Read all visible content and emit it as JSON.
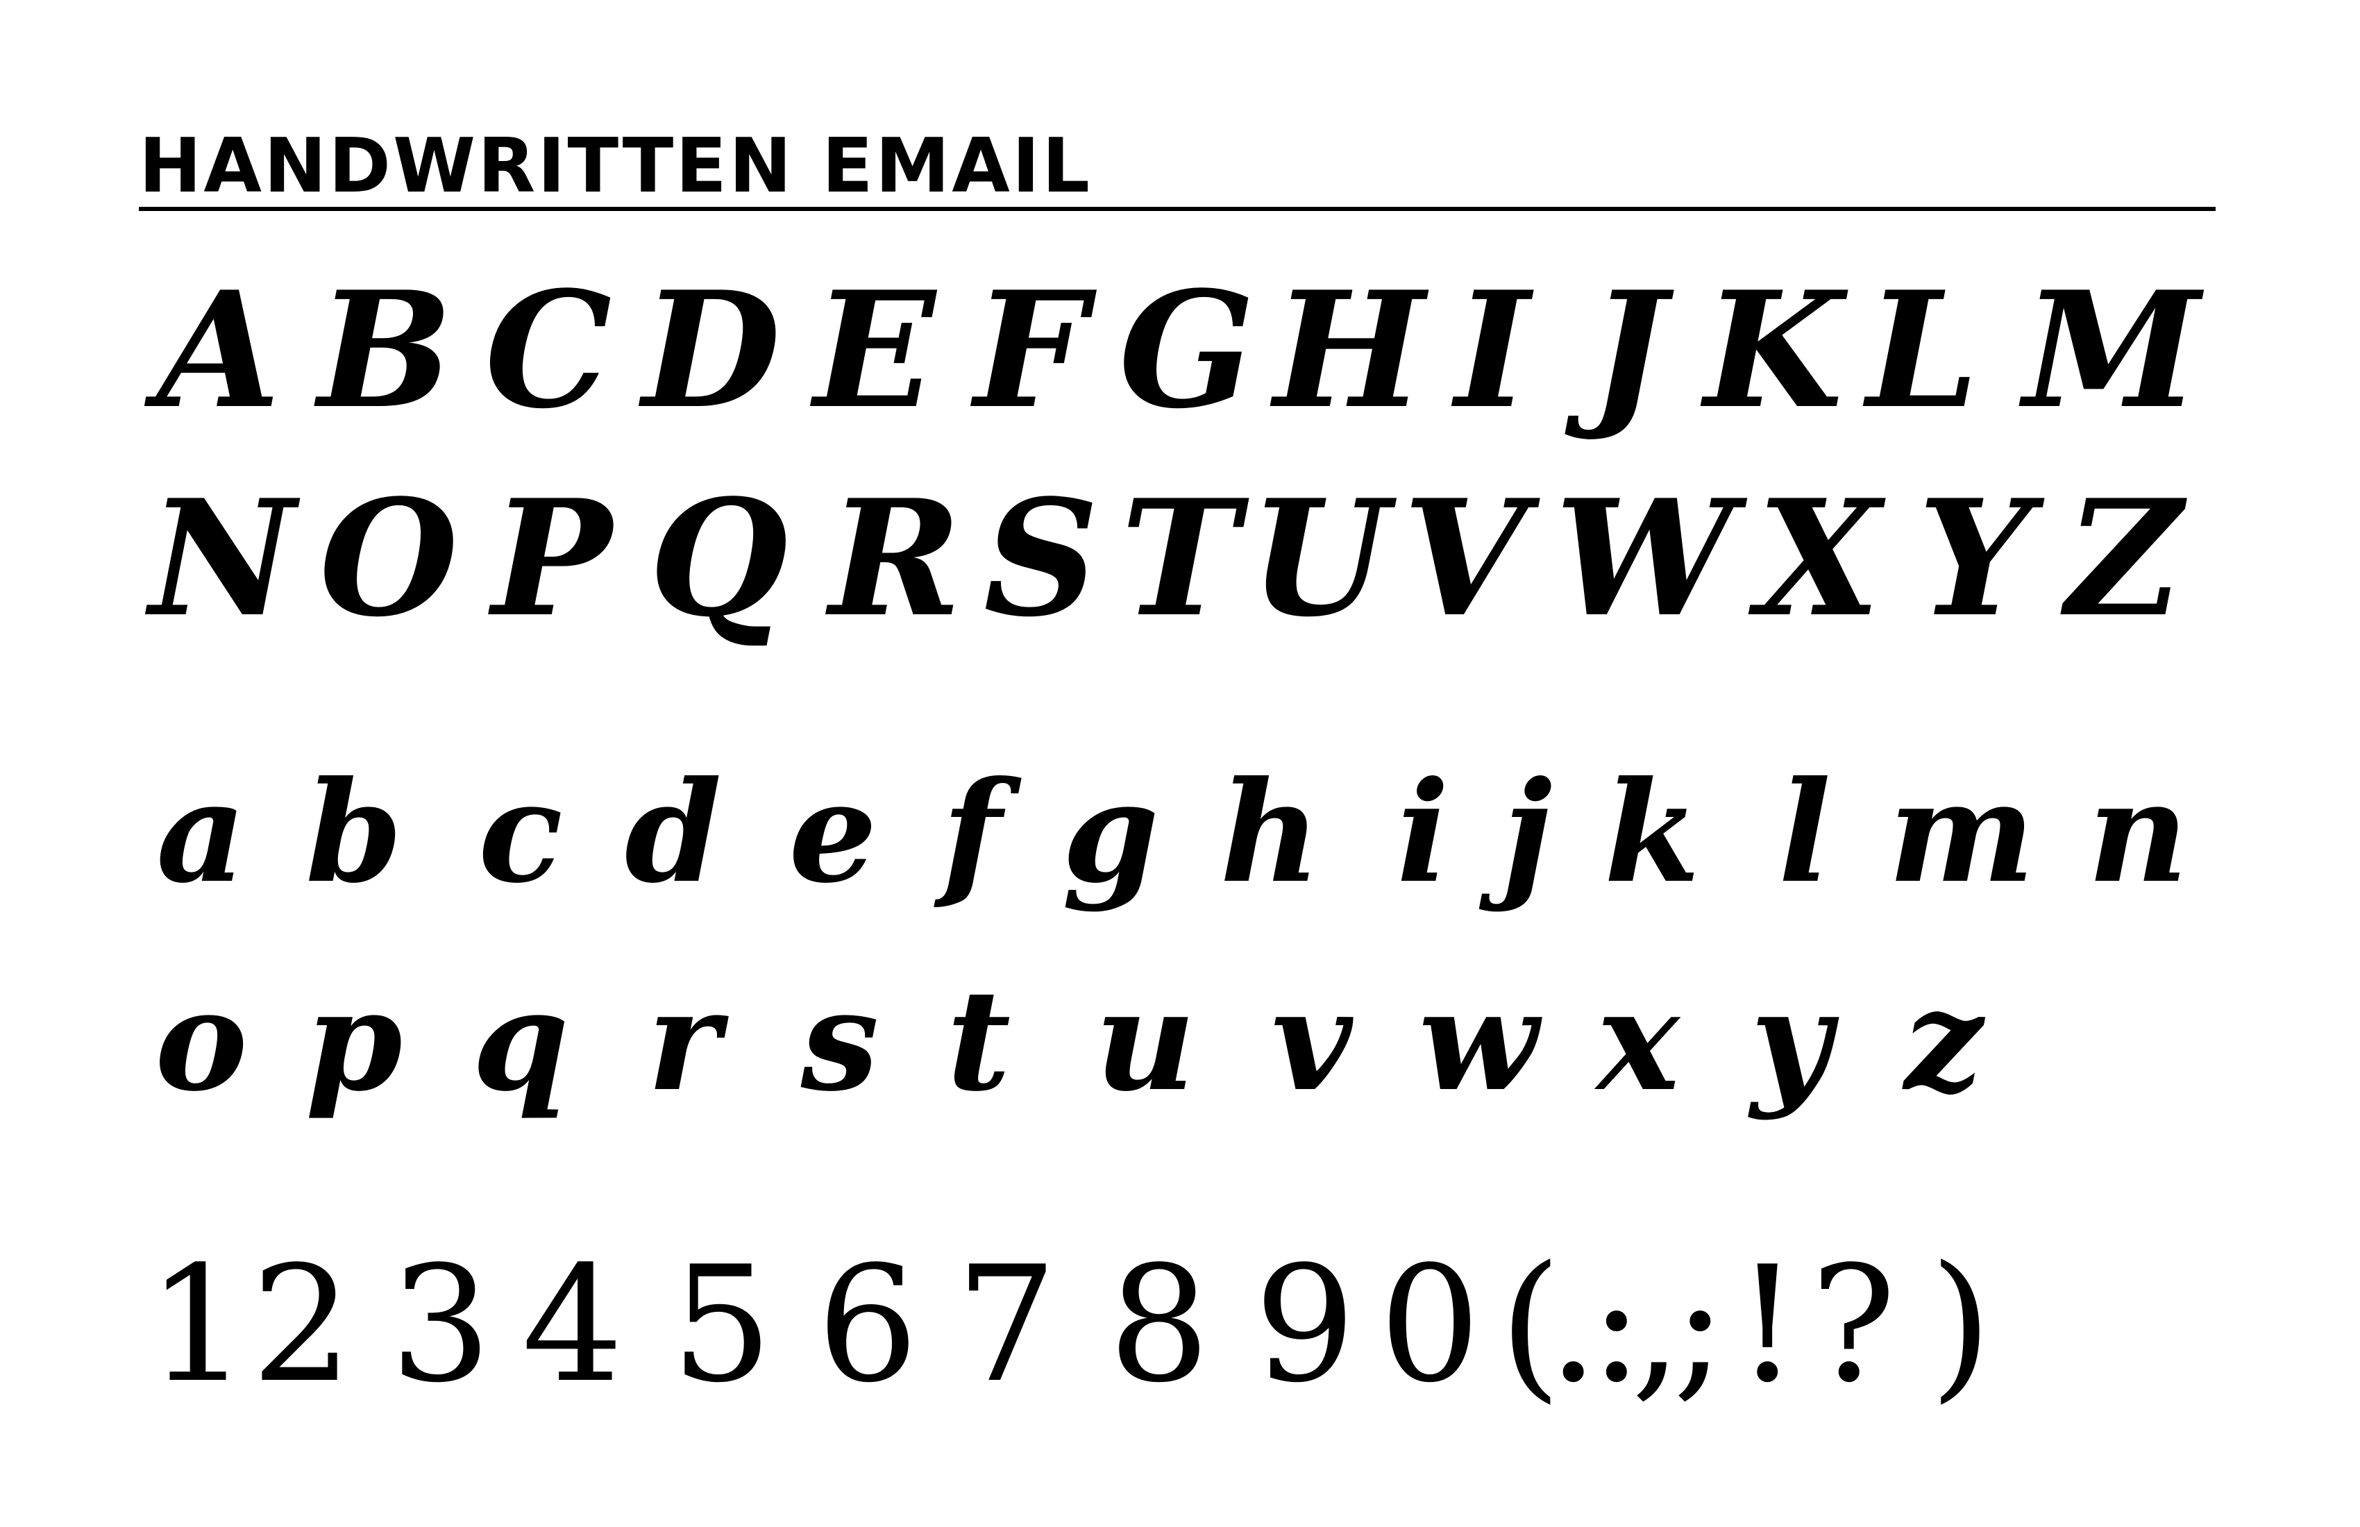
{
  "title": "HANDWRITTEN EMAIL",
  "uppercase_row_1": [
    "A",
    "B",
    "C",
    "D",
    "E",
    "F",
    "G",
    "H",
    "I",
    "J",
    "K",
    "L",
    "M"
  ],
  "uppercase_row_2": [
    "N",
    "O",
    "P",
    "Q",
    "R",
    "S",
    "T",
    "U",
    "V",
    "W",
    "X",
    "Y",
    "Z"
  ],
  "lowercase_row_1": [
    "a",
    "b",
    "c",
    "d",
    "e",
    "f",
    "g",
    "h",
    "i",
    "j",
    "k",
    "l",
    "m",
    "n"
  ],
  "lowercase_row_2": [
    "o",
    "p",
    "q",
    "r",
    "s",
    "t",
    "u",
    "v",
    "w",
    "x",
    "y",
    "z"
  ],
  "digits_row": [
    "1",
    "2",
    "3",
    "4",
    "5",
    "6",
    "7",
    "8",
    "9",
    "0",
    "(",
    ".",
    ":",
    ",",
    ";",
    "!",
    "?",
    ")"
  ]
}
